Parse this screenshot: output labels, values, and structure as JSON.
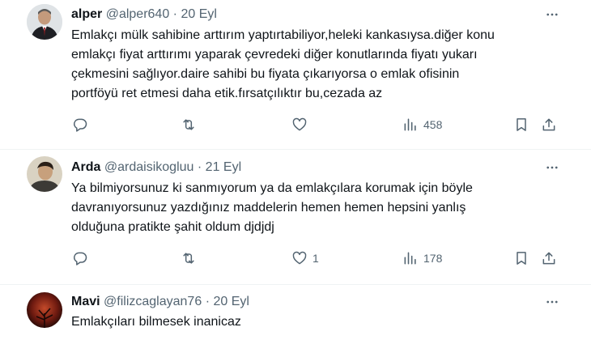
{
  "tweets": [
    {
      "name": "alper",
      "handle": "@alper640",
      "dot": "·",
      "date": "20 Eyl",
      "lines": [
        "Emlakçı mülk sahibine arttırım yaptırtabiliyor,heleki kankasıysa.diğer konu",
        "emlakçı fiyat arttırımı yaparak çevredeki diğer konutlarında fiyatı yukarı",
        "çekmesini sağlıyor.daire sahibi bu fiyata çıkarıyorsa o emlak ofisinin",
        "portföyü ret etmesi daha etik.fırsatçılıktır bu,cezada az"
      ],
      "likes": "",
      "views": "458"
    },
    {
      "name": "Arda",
      "handle": "@ardaisikogluu",
      "dot": "·",
      "date": "21 Eyl",
      "lines": [
        "Ya bilmiyorsunuz ki sanmıyorum ya da emlakçılara korumak için böyle",
        "davranıyorsunuz yazdığınız maddelerin hemen hemen hepsini yanlış",
        "olduğuna pratikte şahit oldum djdjdj"
      ],
      "likes": "1",
      "views": "178"
    },
    {
      "name": "Mavi",
      "handle": "@filizcaglayan76",
      "dot": "·",
      "date": "20 Eyl",
      "lines": [
        "Emlakçıları bilmesek inanicaz"
      ]
    }
  ],
  "icons": {
    "more": "more-icon",
    "reply": "reply-icon",
    "retweet": "retweet-icon",
    "like": "like-icon",
    "views": "views-icon",
    "bookmark": "bookmark-icon",
    "share": "share-icon"
  },
  "colors": {
    "text": "#0f1419",
    "secondary": "#536471",
    "divider": "#eff3f4"
  }
}
